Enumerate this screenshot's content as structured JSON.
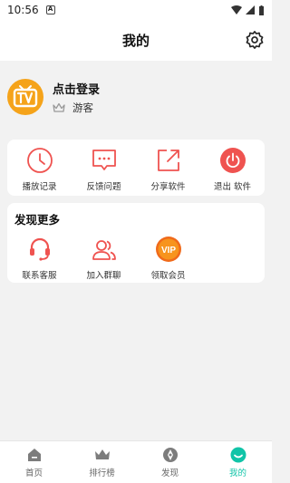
{
  "status": {
    "time": "10:56",
    "notif_glyph": "A"
  },
  "header": {
    "title": "我的"
  },
  "profile": {
    "login": "点击登录",
    "level": "游客"
  },
  "quick_actions": [
    {
      "label": "播放记录",
      "icon": "clock-icon"
    },
    {
      "label": "反馈问题",
      "icon": "chat-icon"
    },
    {
      "label": "分享软件",
      "icon": "share-icon"
    },
    {
      "label": "退出 软件",
      "icon": "power-icon"
    }
  ],
  "discover": {
    "title": "发现更多",
    "items": [
      {
        "label": "联系客服",
        "icon": "headset-icon"
      },
      {
        "label": "加入群聊",
        "icon": "group-icon"
      },
      {
        "label": "领取会员",
        "icon": "vip-icon"
      }
    ]
  },
  "tabs": [
    {
      "label": "首页",
      "icon": "home-icon"
    },
    {
      "label": "排行榜",
      "icon": "crown-icon"
    },
    {
      "label": "发现",
      "icon": "compass-icon"
    },
    {
      "label": "我的",
      "icon": "smile-icon",
      "active": true
    }
  ],
  "colors": {
    "accent": "#11c4a8",
    "icon_red": "#ef5350",
    "avatar_orange": "#f5a31a"
  }
}
